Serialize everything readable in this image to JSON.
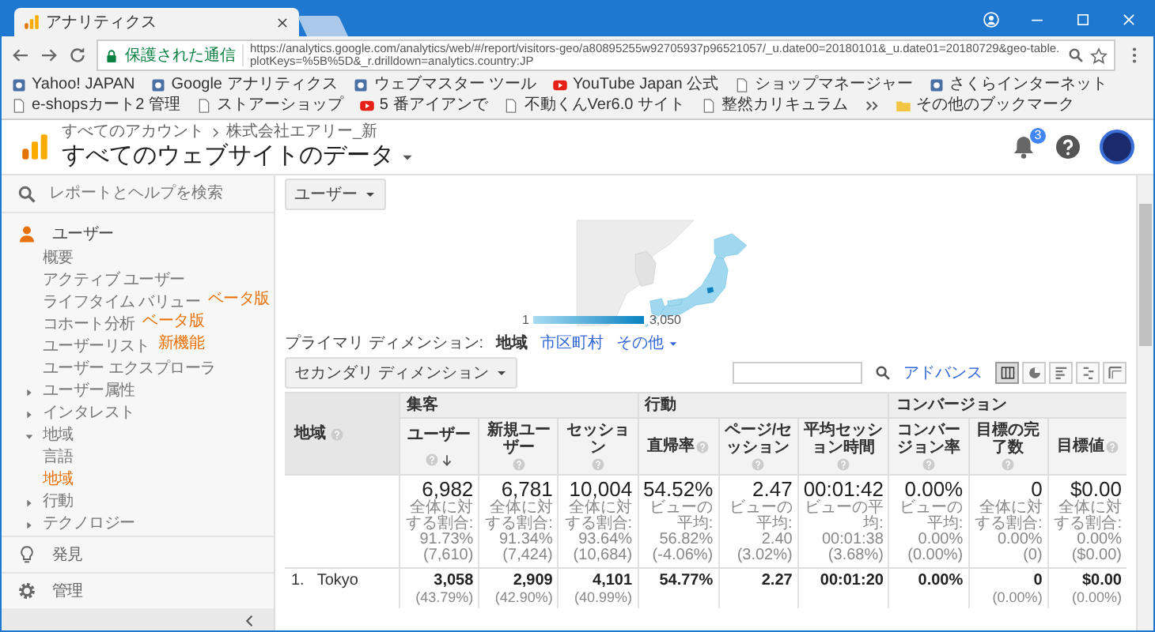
{
  "browser": {
    "tab_title": "アナリティクス",
    "secure_label": "保護された通信",
    "url": "https://analytics.google.com/analytics/web/#/report/visitors-geo/a80895255w92705937p96521057/_u.date00=20180101&_u.date01=20180729&geo-table.plotKeys=%5B%5D&_r.drilldown=analytics.country:JP",
    "bookmarks": [
      {
        "label": "Yahoo! JAPAN",
        "kind": "site"
      },
      {
        "label": "Google アナリティクス",
        "kind": "site"
      },
      {
        "label": "ウェブマスター ツール",
        "kind": "site"
      },
      {
        "label": "YouTube Japan 公式",
        "kind": "video"
      },
      {
        "label": "ショップマネージャー",
        "kind": "page"
      },
      {
        "label": "さくらインターネット",
        "kind": "site"
      },
      {
        "label": "e-shopsカート2 管理",
        "kind": "page"
      },
      {
        "label": "ストアーショップ",
        "kind": "page"
      },
      {
        "label": "5 番アイアンで",
        "kind": "video"
      },
      {
        "label": "不動くんVer6.0 サイト",
        "kind": "page"
      },
      {
        "label": "整然カリキュラム",
        "kind": "page"
      },
      {
        "label": "その他のブックマーク",
        "kind": "folder"
      }
    ]
  },
  "header": {
    "breadcrumb": [
      "すべてのアカウント",
      "株式会社エアリー_新"
    ],
    "title": "すべてのウェブサイトのデータ",
    "notification_count": "3"
  },
  "sidebar": {
    "search_placeholder": "レポートとヘルプを検索",
    "section": {
      "label": "ユーザー",
      "items": [
        {
          "kind": "link",
          "label": "概要",
          "selected": false
        },
        {
          "kind": "link",
          "label": "アクティブ ユーザー",
          "selected": false
        },
        {
          "kind": "link",
          "label": "ライフタイム バリュー",
          "badge": "ベータ版",
          "selected": false
        },
        {
          "kind": "link",
          "label": "コホート分析",
          "badge": "ベータ版",
          "selected": false
        },
        {
          "kind": "link",
          "label": "ユーザーリスト",
          "badge": "新機能",
          "selected": false
        },
        {
          "kind": "link",
          "label": "ユーザー エクスプローラ",
          "selected": false
        },
        {
          "kind": "group",
          "label": "ユーザー属性",
          "expanded": false
        },
        {
          "kind": "group",
          "label": "インタレスト",
          "expanded": false
        },
        {
          "kind": "group",
          "label": "地域",
          "expanded": true,
          "children": [
            {
              "kind": "link",
              "label": "言語",
              "selected": false
            },
            {
              "kind": "link",
              "label": "地域",
              "selected": true
            }
          ]
        },
        {
          "kind": "group",
          "label": "行動",
          "expanded": false
        },
        {
          "kind": "group",
          "label": "テクノロジー",
          "expanded": false
        }
      ]
    },
    "nav": [
      {
        "kind": "discover",
        "label": "発見"
      },
      {
        "kind": "admin",
        "label": "管理"
      }
    ]
  },
  "report": {
    "metric_dropdown": "ユーザー",
    "map": {
      "legend_min": "1",
      "legend_max": "3,050"
    },
    "primary_dimension": {
      "label": "プライマリ ディメンション:",
      "options": [
        {
          "label": "地域",
          "selected": true,
          "kind": "option"
        },
        {
          "label": "市区町村",
          "selected": false,
          "kind": "option"
        },
        {
          "label": "その他",
          "selected": false,
          "kind": "menu"
        }
      ]
    },
    "secondary_dimension": "セカンダリ ディメンション",
    "advanced_link": "アドバンス",
    "views": [
      {
        "kind": "table",
        "selected": true
      },
      {
        "kind": "pie",
        "selected": false
      },
      {
        "kind": "performance",
        "selected": false
      },
      {
        "kind": "comparison",
        "selected": false
      },
      {
        "kind": "pivot",
        "selected": false
      }
    ],
    "table": {
      "dimension": "地域",
      "groups": [
        {
          "label": "集客",
          "columns": [
            {
              "label": "ユーザー",
              "sorted": true
            },
            {
              "label": "新規ユーザー",
              "sorted": false
            },
            {
              "label": "セッション",
              "sorted": false
            }
          ]
        },
        {
          "label": "行動",
          "columns": [
            {
              "label": "直帰率",
              "sorted": false
            },
            {
              "label": "ページ/セッション",
              "sorted": false
            },
            {
              "label": "平均セッション時間",
              "sorted": false
            }
          ]
        },
        {
          "label": "コンバージョン",
          "columns": [
            {
              "label": "コンバージョン率",
              "sorted": false
            },
            {
              "label": "目標の完了数",
              "sorted": false
            },
            {
              "label": "目標値",
              "sorted": false
            }
          ]
        }
      ],
      "totals": [
        {
          "value": "6,982",
          "note": "全体に対する割合: 91.73% (7,610)"
        },
        {
          "value": "6,781",
          "note": "全体に対する割合: 91.34% (7,424)"
        },
        {
          "value": "10,004",
          "note": "全体に対する割合: 93.64% (10,684)"
        },
        {
          "value": "54.52%",
          "note": "ビューの平均: 56.82% (-4.06%)"
        },
        {
          "value": "2.47",
          "note": "ビューの平均: 2.40 (3.02%)"
        },
        {
          "value": "00:01:42",
          "note": "ビューの平均: 00:01:38 (3.68%)"
        },
        {
          "value": "0.00%",
          "note": "ビューの平均: 0.00% (0.00%)"
        },
        {
          "value": "0",
          "note": "全体に対する割合: 0.00% (0)"
        },
        {
          "value": "$0.00",
          "note": "全体に対する割合: 0.00% ($0.00)"
        }
      ],
      "rows": [
        {
          "rank": "1.",
          "name": "Tokyo",
          "cells": [
            {
              "value": "3,058",
              "share": "(43.79%)"
            },
            {
              "value": "2,909",
              "share": "(42.90%)"
            },
            {
              "value": "4,101",
              "share": "(40.99%)"
            },
            {
              "value": "54.77%"
            },
            {
              "value": "2.27"
            },
            {
              "value": "00:01:20"
            },
            {
              "value": "0.00%"
            },
            {
              "value": "0",
              "share": "(0.00%)"
            },
            {
              "value": "$0.00",
              "share": "(0.00%)"
            }
          ]
        }
      ]
    }
  }
}
